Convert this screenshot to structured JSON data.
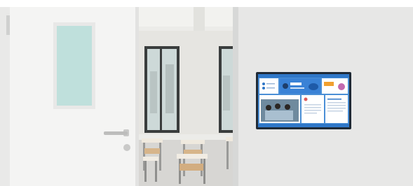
{
  "scene": {
    "description_tags": [
      "door",
      "classroom",
      "wall-display"
    ],
    "colors": {
      "door": "#f4f4f3",
      "door_edge": "#e2e2e1",
      "glass": "#bfe0dc",
      "wall": "#e7e7e6",
      "frame": "#cfd0cf",
      "window_frame": "#3a3d3d",
      "window_glass": "#cdd9d8",
      "floor": "#d7d6d3",
      "desk": "#efe9de",
      "chair": "#d7b58a",
      "screen_bezel": "#1f2a36",
      "screen_bg": "#4a8fd6",
      "panel": "#ffffff",
      "accent": "#2f77c8"
    }
  }
}
